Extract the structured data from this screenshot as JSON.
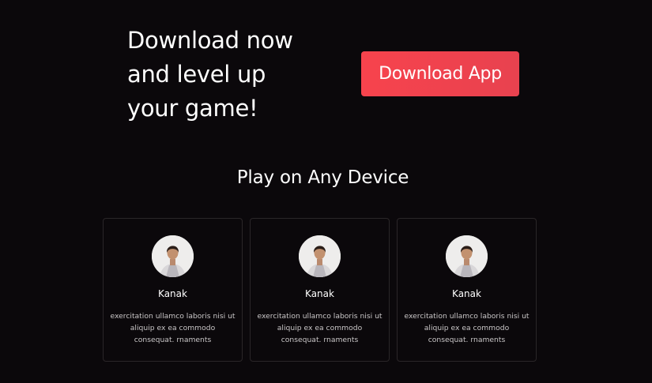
{
  "hero": {
    "line1": "Download now",
    "line2": "and level up",
    "line3": "your game!",
    "download_button_label": "Download App"
  },
  "section": {
    "title": "Play on Any Device"
  },
  "cards": [
    {
      "name": "Kanak",
      "text": "exercitation ullamco laboris nisi ut aliquip ex ea commodo consequat. rnaments"
    },
    {
      "name": "Kanak",
      "text": "exercitation ullamco laboris nisi ut aliquip ex ea commodo consequat. rnaments"
    },
    {
      "name": "Kanak",
      "text": "exercitation ullamco laboris nisi ut aliquip ex ea commodo consequat. rnaments"
    }
  ],
  "colors": {
    "background": "#0b080b",
    "button_accent": "#f7434d",
    "card_border": "#2a2628"
  }
}
